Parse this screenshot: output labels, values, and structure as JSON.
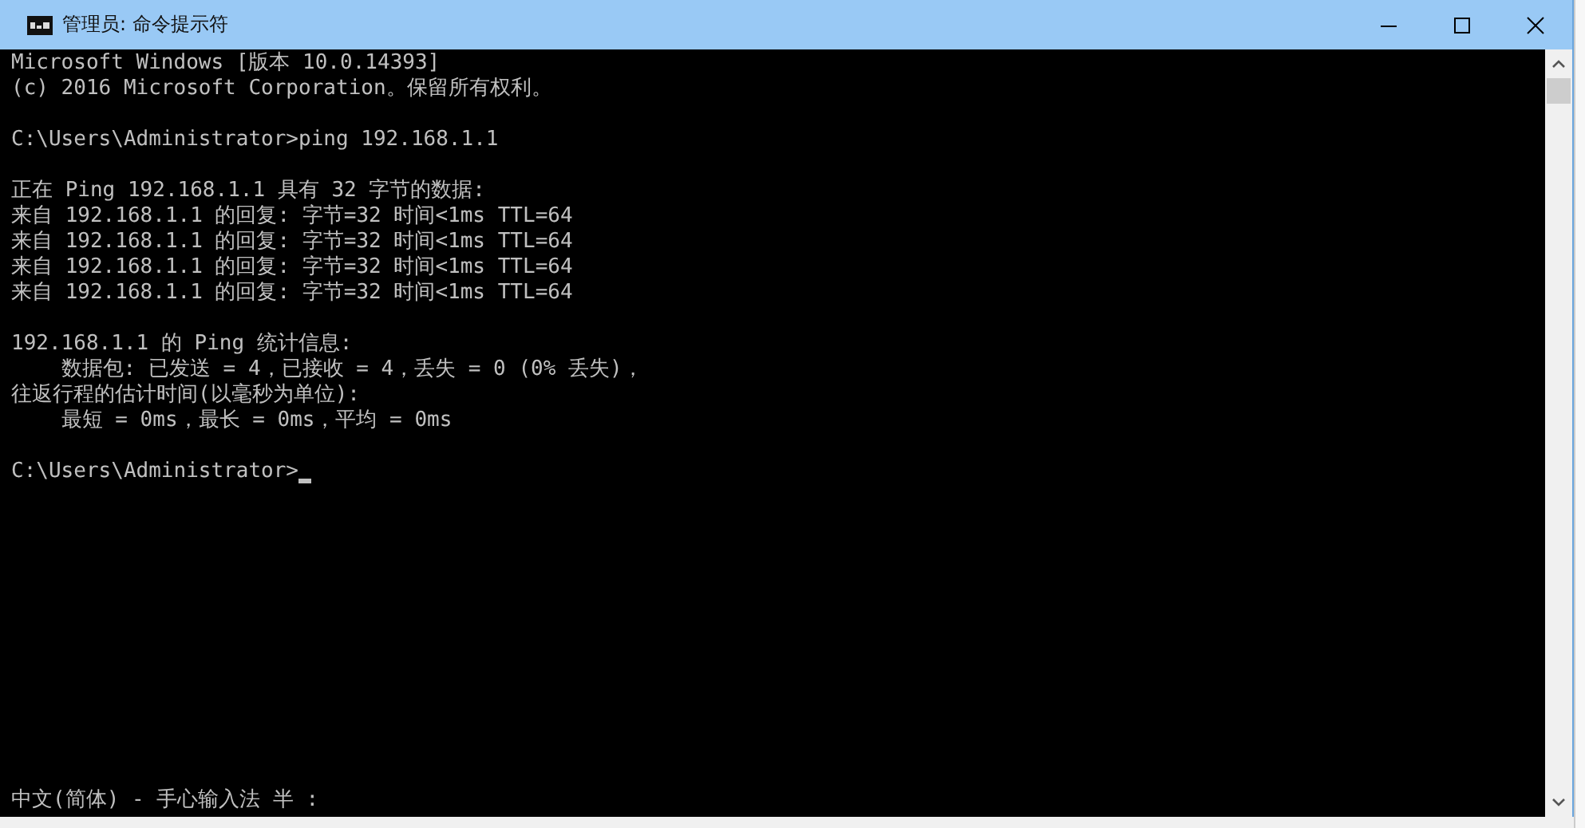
{
  "window": {
    "title": "管理员: 命令提示符"
  },
  "console": {
    "blocks": [
      {
        "lines": [
          "Microsoft Windows [版本 10.0.14393]",
          "(c) 2016 Microsoft Corporation。保留所有权利。"
        ]
      },
      {
        "lines": [
          "C:\\Users\\Administrator>ping 192.168.1.1"
        ]
      },
      {
        "lines": [
          "正在 Ping 192.168.1.1 具有 32 字节的数据:",
          "来自 192.168.1.1 的回复: 字节=32 时间<1ms TTL=64",
          "来自 192.168.1.1 的回复: 字节=32 时间<1ms TTL=64",
          "来自 192.168.1.1 的回复: 字节=32 时间<1ms TTL=64",
          "来自 192.168.1.1 的回复: 字节=32 时间<1ms TTL=64"
        ]
      },
      {
        "lines": [
          "192.168.1.1 的 Ping 统计信息:",
          "    数据包: 已发送 = 4，已接收 = 4，丢失 = 0 (0% 丢失)，",
          "往返行程的估计时间(以毫秒为单位):",
          "    最短 = 0ms，最长 = 0ms，平均 = 0ms"
        ]
      },
      {
        "lines": [
          "C:\\Users\\Administrator>"
        ],
        "cursor": true
      }
    ],
    "ime_status": "中文(简体) - 手心输入法 半 :"
  }
}
